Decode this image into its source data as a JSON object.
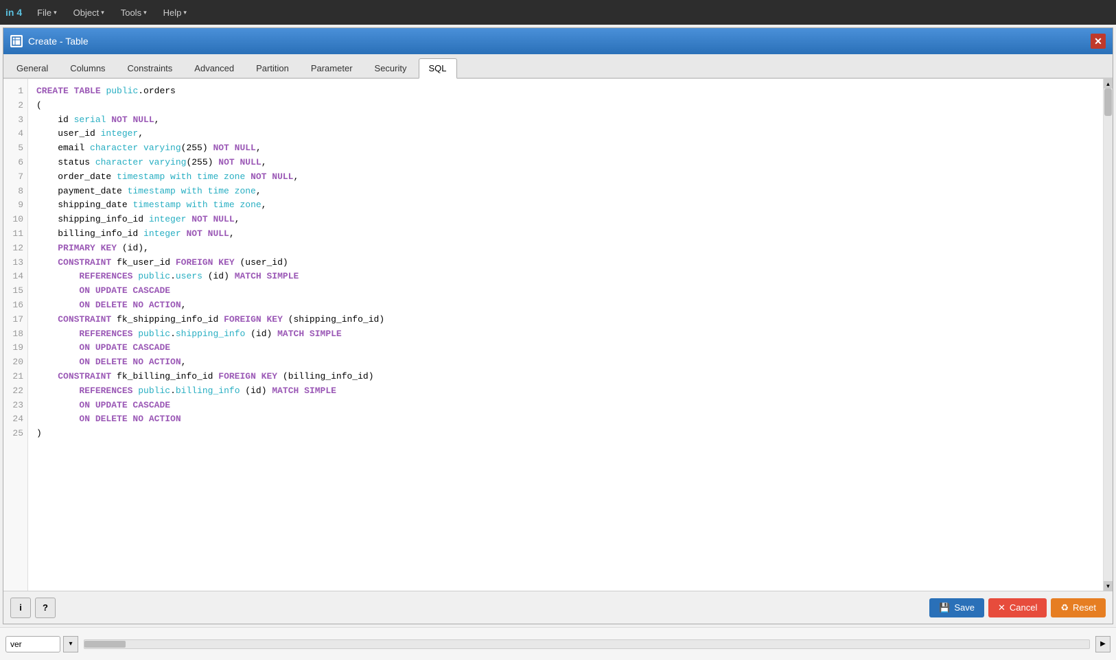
{
  "app": {
    "brand": "in 4",
    "menus": [
      {
        "label": "File",
        "arrow": "▾"
      },
      {
        "label": "Object",
        "arrow": "▾"
      },
      {
        "label": "Tools",
        "arrow": "▾"
      },
      {
        "label": "Help",
        "arrow": "▾"
      }
    ]
  },
  "dialog": {
    "title": "Create - Table",
    "close_label": "✕",
    "tabs": [
      {
        "id": "general",
        "label": "General"
      },
      {
        "id": "columns",
        "label": "Columns"
      },
      {
        "id": "constraints",
        "label": "Constraints"
      },
      {
        "id": "advanced",
        "label": "Advanced"
      },
      {
        "id": "partition",
        "label": "Partition"
      },
      {
        "id": "parameter",
        "label": "Parameter"
      },
      {
        "id": "security",
        "label": "Security"
      },
      {
        "id": "sql",
        "label": "SQL",
        "active": true
      }
    ]
  },
  "sql": {
    "lines": [
      {
        "num": "1",
        "code": "CREATE TABLE public.orders"
      },
      {
        "num": "2",
        "code": "("
      },
      {
        "num": "3",
        "code": "    id serial NOT NULL,"
      },
      {
        "num": "4",
        "code": "    user_id integer,"
      },
      {
        "num": "5",
        "code": "    email character varying(255) NOT NULL,"
      },
      {
        "num": "6",
        "code": "    status character varying(255) NOT NULL,"
      },
      {
        "num": "7",
        "code": "    order_date timestamp with time zone NOT NULL,"
      },
      {
        "num": "8",
        "code": "    payment_date timestamp with time zone,"
      },
      {
        "num": "9",
        "code": "    shipping_date timestamp with time zone,"
      },
      {
        "num": "10",
        "code": "    shipping_info_id integer NOT NULL,"
      },
      {
        "num": "11",
        "code": "    billing_info_id integer NOT NULL,"
      },
      {
        "num": "12",
        "code": "    PRIMARY KEY (id),"
      },
      {
        "num": "13",
        "code": "    CONSTRAINT fk_user_id FOREIGN KEY (user_id)"
      },
      {
        "num": "14",
        "code": "        REFERENCES public.users (id) MATCH SIMPLE"
      },
      {
        "num": "15",
        "code": "        ON UPDATE CASCADE"
      },
      {
        "num": "16",
        "code": "        ON DELETE NO ACTION,"
      },
      {
        "num": "17",
        "code": "    CONSTRAINT fk_shipping_info_id FOREIGN KEY (shipping_info_id)"
      },
      {
        "num": "18",
        "code": "        REFERENCES public.shipping_info (id) MATCH SIMPLE"
      },
      {
        "num": "19",
        "code": "        ON UPDATE CASCADE"
      },
      {
        "num": "20",
        "code": "        ON DELETE NO ACTION,"
      },
      {
        "num": "21",
        "code": "    CONSTRAINT fk_billing_info_id FOREIGN KEY (billing_info_id)"
      },
      {
        "num": "22",
        "code": "        REFERENCES public.billing_info (id) MATCH SIMPLE"
      },
      {
        "num": "23",
        "code": "        ON UPDATE CASCADE"
      },
      {
        "num": "24",
        "code": "        ON DELETE NO ACTION"
      },
      {
        "num": "25",
        "code": ")"
      }
    ]
  },
  "bottom": {
    "info_btn": "i",
    "help_btn": "?",
    "save_label": "Save",
    "cancel_label": "Cancel",
    "reset_label": "Reset"
  },
  "statusbar": {
    "input_value": "ver",
    "dropdown_arrow": "▾",
    "expand_arrow": "▶"
  }
}
